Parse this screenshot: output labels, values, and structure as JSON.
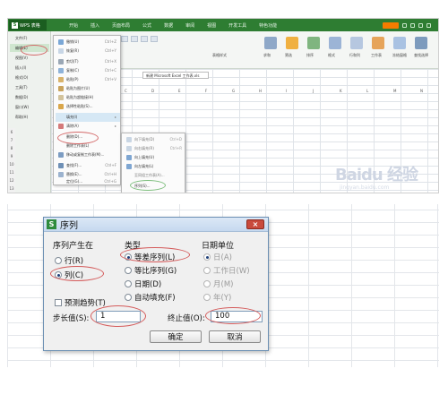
{
  "top_screenshot": {
    "app_button": "WPS 表格",
    "menu_tabs": [
      "开始",
      "插入",
      "页面布局",
      "公式",
      "数据",
      "审阅",
      "视图",
      "开发工具",
      "特色功能"
    ],
    "ribbon_labels": [
      "表格样式",
      "求和",
      "筛选",
      "排序",
      "格式",
      "行和列",
      "工作表",
      "冻结窗格",
      "查找选择"
    ],
    "doc_tab": "新建 Microsoft Excel 工作表.xls",
    "font_size": "12",
    "left_menu": [
      {
        "label": "文件(F)",
        "selected": false
      },
      {
        "label": "编辑(E)",
        "selected": true
      },
      {
        "label": "视图(V)",
        "selected": false
      },
      {
        "label": "插入(I)",
        "selected": false
      },
      {
        "label": "格式(O)",
        "selected": false
      },
      {
        "label": "工具(T)",
        "selected": false
      },
      {
        "label": "数据(D)",
        "selected": false
      },
      {
        "label": "窗口(W)",
        "selected": false
      },
      {
        "label": "帮助(H)",
        "selected": false
      }
    ],
    "edit_menu": [
      {
        "label": "撤销(U)",
        "shortcut": "Ctrl+Z"
      },
      {
        "label": "恢复(R)",
        "shortcut": "Ctrl+Y"
      },
      {
        "label": "剪切(T)",
        "shortcut": "Ctrl+X"
      },
      {
        "label": "复制(C)",
        "shortcut": "Ctrl+C"
      },
      {
        "label": "粘贴(P)",
        "shortcut": "Ctrl+V"
      },
      {
        "label": "粘贴为图片(U)",
        "shortcut": ""
      },
      {
        "label": "粘贴为超链接(H)",
        "shortcut": ""
      },
      {
        "label": "选择性粘贴(S)...",
        "shortcut": ""
      },
      {
        "label": "填充(I)",
        "shortcut": ""
      },
      {
        "label": "清除(A)",
        "shortcut": ""
      },
      {
        "label": "删除(D)...",
        "shortcut": ""
      },
      {
        "label": "删除工作表(L)",
        "shortcut": ""
      },
      {
        "label": "移动或复制工作表(M)...",
        "shortcut": ""
      },
      {
        "label": "查找(F)...",
        "shortcut": "Ctrl+F"
      },
      {
        "label": "替换(E)...",
        "shortcut": "Ctrl+H"
      },
      {
        "label": "定位(G)...",
        "shortcut": "Ctrl+G"
      }
    ],
    "fill_submenu": [
      {
        "label": "向下填充(D)",
        "shortcut": "Ctrl+D",
        "enabled": false
      },
      {
        "label": "向右填充(R)",
        "shortcut": "Ctrl+R",
        "enabled": false
      },
      {
        "label": "向上填充(U)",
        "shortcut": "",
        "enabled": true
      },
      {
        "label": "向左填充(L)",
        "shortcut": "",
        "enabled": true
      },
      {
        "label": "至同组工作表(A)...",
        "shortcut": "",
        "enabled": false
      },
      {
        "label": "序列(S)...",
        "shortcut": "",
        "enabled": true
      }
    ],
    "column_heads": [
      "C",
      "D",
      "E",
      "F",
      "G",
      "H",
      "I",
      "J",
      "K",
      "L",
      "M",
      "N",
      "O",
      "P"
    ],
    "watermark": "Baidu 经验",
    "watermark_sub": "jingyan.baidu.com"
  },
  "series_dialog": {
    "title": "序列",
    "close_symbol": "×",
    "series_in": {
      "label": "序列产生在",
      "options": [
        {
          "label": "行(R)",
          "checked": false
        },
        {
          "label": "列(C)",
          "checked": true
        }
      ]
    },
    "type": {
      "label": "类型",
      "options": [
        {
          "label": "等差序列(L)",
          "checked": true
        },
        {
          "label": "等比序列(G)",
          "checked": false
        },
        {
          "label": "日期(D)",
          "checked": false
        },
        {
          "label": "自动填充(F)",
          "checked": false
        }
      ]
    },
    "date_unit": {
      "label": "日期单位",
      "options": [
        {
          "label": "日(A)",
          "checked": true
        },
        {
          "label": "工作日(W)",
          "checked": false
        },
        {
          "label": "月(M)",
          "checked": false
        },
        {
          "label": "年(Y)",
          "checked": false
        }
      ]
    },
    "trend_label": "预测趋势(T)",
    "step_label": "步长值(S):",
    "step_value": "1",
    "stop_label": "终止值(O):",
    "stop_value": "100",
    "ok_label": "确定",
    "cancel_label": "取消"
  }
}
